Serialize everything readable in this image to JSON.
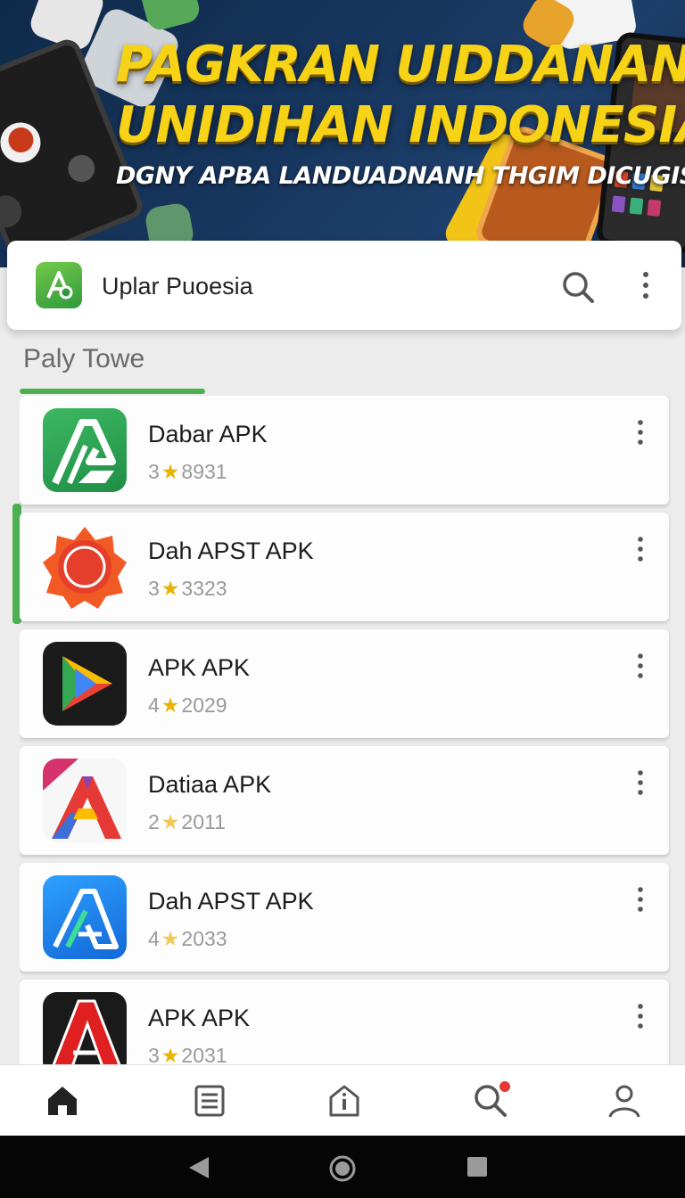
{
  "banner": {
    "title_line1": "PAGKRAN UIDDANAN",
    "title_line2": "UNIDIHAN INDONESIA",
    "subtitle": "DGNY APBA LANDUADNANH THGIM DICUGIS."
  },
  "appbar": {
    "title": "Uplar Puoesia",
    "logo_icon": "apk-a-logo-icon",
    "search_icon": "search-icon",
    "menu_icon": "more-vert-icon"
  },
  "section": {
    "title": "Paly Towe"
  },
  "apps": [
    {
      "name": "Dabar APK",
      "rating": "3",
      "count": "8931",
      "icon": "green-a-app-icon"
    },
    {
      "name": "Dah APST APK",
      "rating": "3",
      "count": "3323",
      "icon": "red-sun-app-icon"
    },
    {
      "name": "APK APK",
      "rating": "4",
      "count": "2029",
      "icon": "play-triangle-app-icon"
    },
    {
      "name": "Datiaa APK",
      "rating": "2",
      "count": "2011",
      "icon": "colorful-a-app-icon"
    },
    {
      "name": "Dah APST APK",
      "rating": "4",
      "count": "2033",
      "icon": "blue-a-app-icon"
    },
    {
      "name": "APK APK",
      "rating": "3",
      "count": "2031",
      "icon": "red-a-app-icon"
    }
  ],
  "bottom_nav": [
    {
      "icon": "home-icon"
    },
    {
      "icon": "list-icon"
    },
    {
      "icon": "info-house-icon"
    },
    {
      "icon": "search-notification-icon"
    },
    {
      "icon": "profile-icon"
    }
  ],
  "colors": {
    "accent_green": "#4caf50",
    "star": "#e8b400",
    "banner_yellow": "#f6d316",
    "banner_bg": "#17365e"
  }
}
